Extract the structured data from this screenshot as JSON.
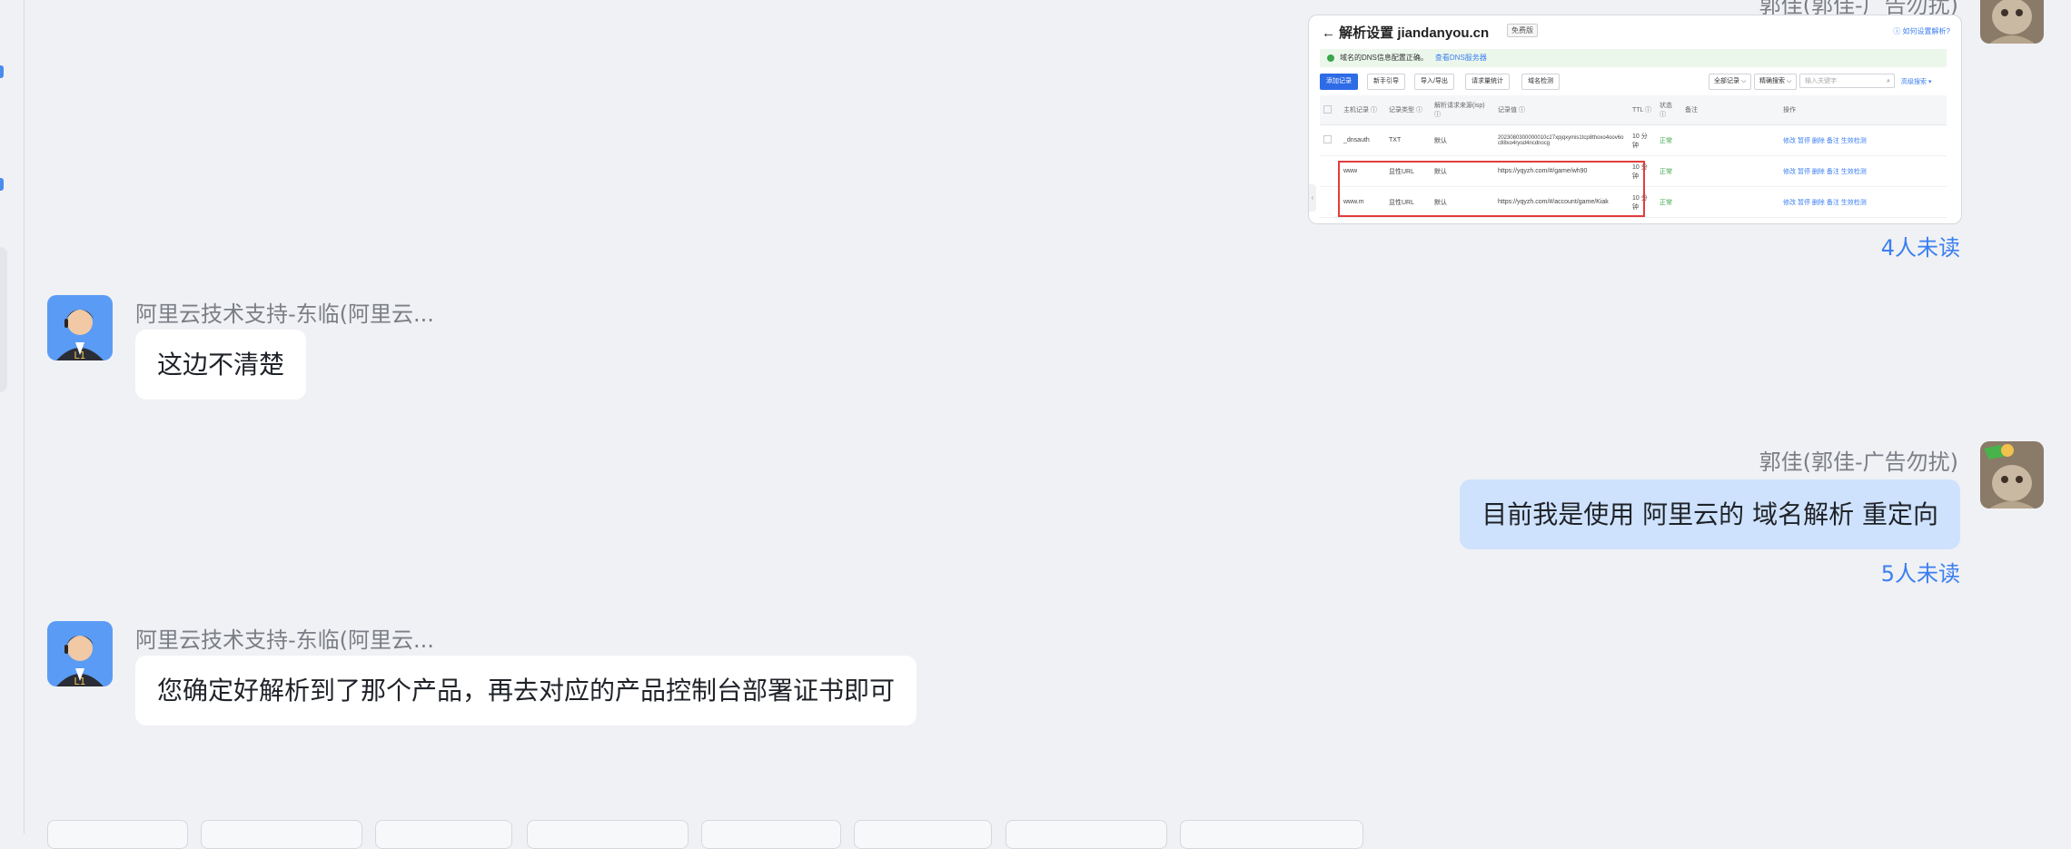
{
  "top_sender": {
    "name": "郭佳(郭佳-广告勿扰)"
  },
  "screenshot": {
    "title": "解析设置 jiandanyou.cn",
    "badge": "免费版",
    "help_link": "如何设置解析?",
    "notice": "域名的DNS信息配置正确。",
    "notice_link": "查看DNS服务器",
    "tabs": [
      "添加记录",
      "新手引导",
      "导入/导出",
      "请求量统计",
      "域名检测"
    ],
    "filters": [
      "全部记录 ⌵",
      "精确搜索 ⌵"
    ],
    "search_placeholder": "输入关键字",
    "advanced": "高级搜索 ▾",
    "columns": [
      "",
      "主机记录 ⓘ",
      "记录类型 ⓘ",
      "解析请求来源(isp) ⓘ",
      "记录值 ⓘ",
      "TTL ⓘ",
      "状态 ⓘ",
      "备注",
      "操作"
    ],
    "rows": [
      [
        "",
        "_dnsauth",
        "TXT",
        "默认",
        "2023080300000010c27xpjqxymis1tcp8thoxo4oov6oc88xo4ryod4ncdnocg",
        "10 分钟",
        "正常",
        "",
        "修改  暂停  删除  备注  生效检测"
      ],
      [
        "",
        "www",
        "显性URL",
        "默认",
        "https://yqyzh.com/#/game/wh90",
        "10 分钟",
        "正常",
        "",
        "修改  暂停  删除  备注  生效检测"
      ],
      [
        "",
        "www.m",
        "显性URL",
        "默认",
        "https://yqyzh.com/#/account/game/Kiak",
        "10 分钟",
        "正常",
        "",
        "修改  暂停  删除  备注  生效检测"
      ]
    ]
  },
  "unread_1": "4人未读",
  "msg_support_1": {
    "name": "阿里云技术支持-东临(阿里云...",
    "text": "这边不清楚"
  },
  "msg_mine": {
    "name": "郭佳(郭佳-广告勿扰)",
    "text": "目前我是使用  阿里云的 域名解析   重定向"
  },
  "unread_2": "5人未读",
  "msg_support_2": {
    "name": "阿里云技术支持-东临(阿里云...",
    "text": "您确定好解析到了那个产品，再去对应的产品控制台部署证书即可"
  },
  "avatar_support_label": "L1",
  "colors": {
    "mine_bubble": "#cfe2fd",
    "unread": "#3b7ff0",
    "accent": "#2e6be6"
  }
}
